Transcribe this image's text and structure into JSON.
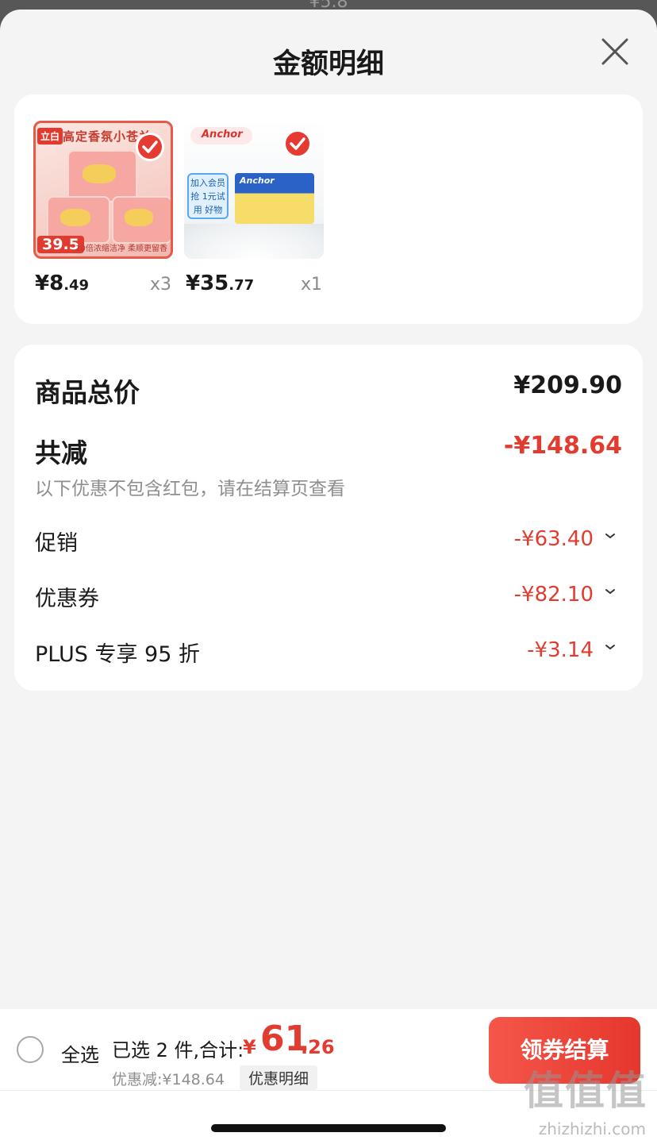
{
  "backdrop": {
    "peek_text": "¥5.8"
  },
  "sheet": {
    "title": "金额明细"
  },
  "products": [
    {
      "name": "Liby product",
      "thumb": {
        "brand_tag": "立白",
        "banner": "高定香氛小苍兰",
        "price_badge": "39.5",
        "footer": "10倍浓缩洁净 柔顺更留香"
      },
      "price_int": "¥8",
      "price_dec": ".49",
      "qty": "x3",
      "checked": true
    },
    {
      "name": "Anchor product",
      "thumb": {
        "brand_tag": "Anchor",
        "badge": "加入会员抢 1元试用 好物"
      },
      "price_int": "¥35",
      "price_dec": ".77",
      "qty": "x1",
      "checked": true
    }
  ],
  "summary": {
    "total_label": "商品总价",
    "total_value": "¥209.90",
    "reduce_label": "共减",
    "reduce_value": "-¥148.64",
    "reduce_hint": "以下优惠不包含红包，请在结算页查看",
    "items": [
      {
        "label": "促销",
        "value": "-¥63.40"
      },
      {
        "label": "优惠券",
        "value": "-¥82.10"
      },
      {
        "label": "PLUS 专享 95 折",
        "value": "-¥3.14"
      }
    ]
  },
  "bottom_bar": {
    "select_all": "全选",
    "selected_text": "已选 2 件,合计:",
    "total_currency": "¥",
    "total_int": "61",
    "total_dec": ".26",
    "discount_text": "优惠减:¥148.64",
    "detail_link": "优惠明细",
    "checkout_label": "领券结算"
  },
  "watermark": {
    "main": "值值值",
    "sub": "zhizhizhi.com"
  },
  "colors": {
    "accent_red": "#e23b30",
    "sheet_bg": "#f4f4f4",
    "overlay": "#575757"
  },
  "icons": [
    "close-icon",
    "checkmark-icon",
    "chevron-down-icon"
  ]
}
